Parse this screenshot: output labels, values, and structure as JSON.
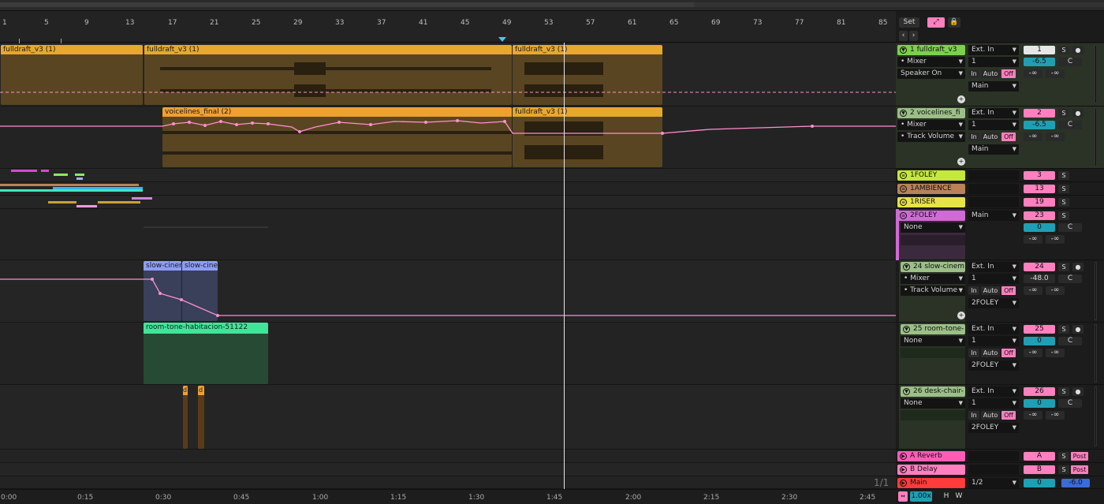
{
  "colors": {
    "bg": "#1e1e1e",
    "clip_yellow": "#e7a82b",
    "clip_orange": "#f0a030",
    "automation": "#ff8fcf",
    "track_green": "#7bd14d",
    "foley_lime": "#c6e83b",
    "ambience_brown": "#b8835a",
    "riser_yellow": "#e8e24a",
    "foley2_purple": "#cf6ad6",
    "sage": "#9cbf88",
    "reverb_pink": "#ff5cb8",
    "delay_pink": "#ff7fbf",
    "main_red": "#ff3b3b",
    "teal": "#1f9fb3",
    "room_tone_green": "#3fe69a",
    "slow_cine_blue": "#8e9cf5"
  },
  "ruler": {
    "bars": [
      "1",
      "5",
      "9",
      "13",
      "17",
      "21",
      "25",
      "29",
      "33",
      "37",
      "41",
      "45",
      "49",
      "53",
      "57",
      "61",
      "65",
      "69",
      "73",
      "77",
      "81",
      "85"
    ]
  },
  "header": {
    "set_label": "Set",
    "prev_icon": "arrow-left-icon",
    "next_icon": "arrow-right-icon"
  },
  "bottom": {
    "times": [
      "0:00",
      "0:15",
      "0:30",
      "0:45",
      "1:00",
      "1:15",
      "1:30",
      "1:45",
      "2:00",
      "2:15",
      "2:30",
      "2:45"
    ],
    "page": "1/1",
    "zoom": "1.00x",
    "h_label": "H",
    "w_label": "W"
  },
  "clips": {
    "t1_a": "fulldraft_v3  (1)",
    "t1_b": "fulldraft_v3  (1)",
    "t1_c": "fulldraft_v3  (1)",
    "t2_a": "voicelines_final  (2)",
    "t2_b": "fulldraft_v3  (1)",
    "slow_a": "slow-cinem",
    "slow_b": "slow-cinem",
    "room": "room-tone-habitacion-51122",
    "d1": "d",
    "d2": "d"
  },
  "tracks": [
    {
      "name": "1 fulldraft_v3",
      "input": "Ext. In",
      "monitor": "Mixer",
      "sub": "Speaker On",
      "channel": "1",
      "out": "Main",
      "num": "1",
      "vol": "-6.5",
      "pan": "C",
      "sends": [
        "-∞",
        "-∞"
      ],
      "in": "In",
      "auto": "Auto",
      "off": "Off",
      "s": "S"
    },
    {
      "name": "2 voicelines_fi",
      "input": "Ext. In",
      "monitor": "Mixer",
      "sub": "Track Volume",
      "channel": "1",
      "out": "Main",
      "num": "2",
      "vol": "-6.5",
      "pan": "C",
      "sends": [
        "-∞",
        "-∞"
      ],
      "in": "In",
      "auto": "Auto",
      "off": "Off",
      "s": "S"
    },
    {
      "name": "1FOLEY",
      "num": "3",
      "s": "S"
    },
    {
      "name": "1AMBIENCE",
      "num": "13",
      "s": "S"
    },
    {
      "name": "1RISER",
      "num": "19",
      "s": "S"
    },
    {
      "name": "2FOLEY",
      "monitor": "None",
      "out": "Main",
      "num": "23",
      "vol": "0",
      "pan": "C",
      "sends": [
        "-∞",
        "-∞"
      ],
      "s": "S"
    },
    {
      "name": "24 slow-cinem",
      "input": "Ext. In",
      "monitor": "Mixer",
      "sub": "Track Volume",
      "channel": "1",
      "out": "2FOLEY",
      "num": "24",
      "vol": "-48.0",
      "pan": "C",
      "sends": [
        "-∞",
        "-∞"
      ],
      "in": "In",
      "auto": "Auto",
      "off": "Off",
      "s": "S"
    },
    {
      "name": "25 room-tone-",
      "input": "Ext. In",
      "monitor": "None",
      "channel": "1",
      "out": "2FOLEY",
      "num": "25",
      "vol": "0",
      "pan": "C",
      "sends": [
        "-∞",
        "-∞"
      ],
      "in": "In",
      "auto": "Auto",
      "off": "Off",
      "s": "S"
    },
    {
      "name": "26 desk-chair-",
      "input": "Ext. In",
      "monitor": "None",
      "channel": "1",
      "out": "2FOLEY",
      "num": "26",
      "vol": "0",
      "pan": "C",
      "sends": [
        "-∞",
        "-∞"
      ],
      "in": "In",
      "auto": "Auto",
      "off": "Off",
      "s": "S"
    },
    {
      "name": "A Reverb",
      "num": "A",
      "s": "S",
      "post": "Post"
    },
    {
      "name": "B Delay",
      "num": "B",
      "s": "S",
      "post": "Post"
    },
    {
      "name": "Main",
      "out": "1/2",
      "vol": "0",
      "main_vol": "-6.0"
    }
  ]
}
